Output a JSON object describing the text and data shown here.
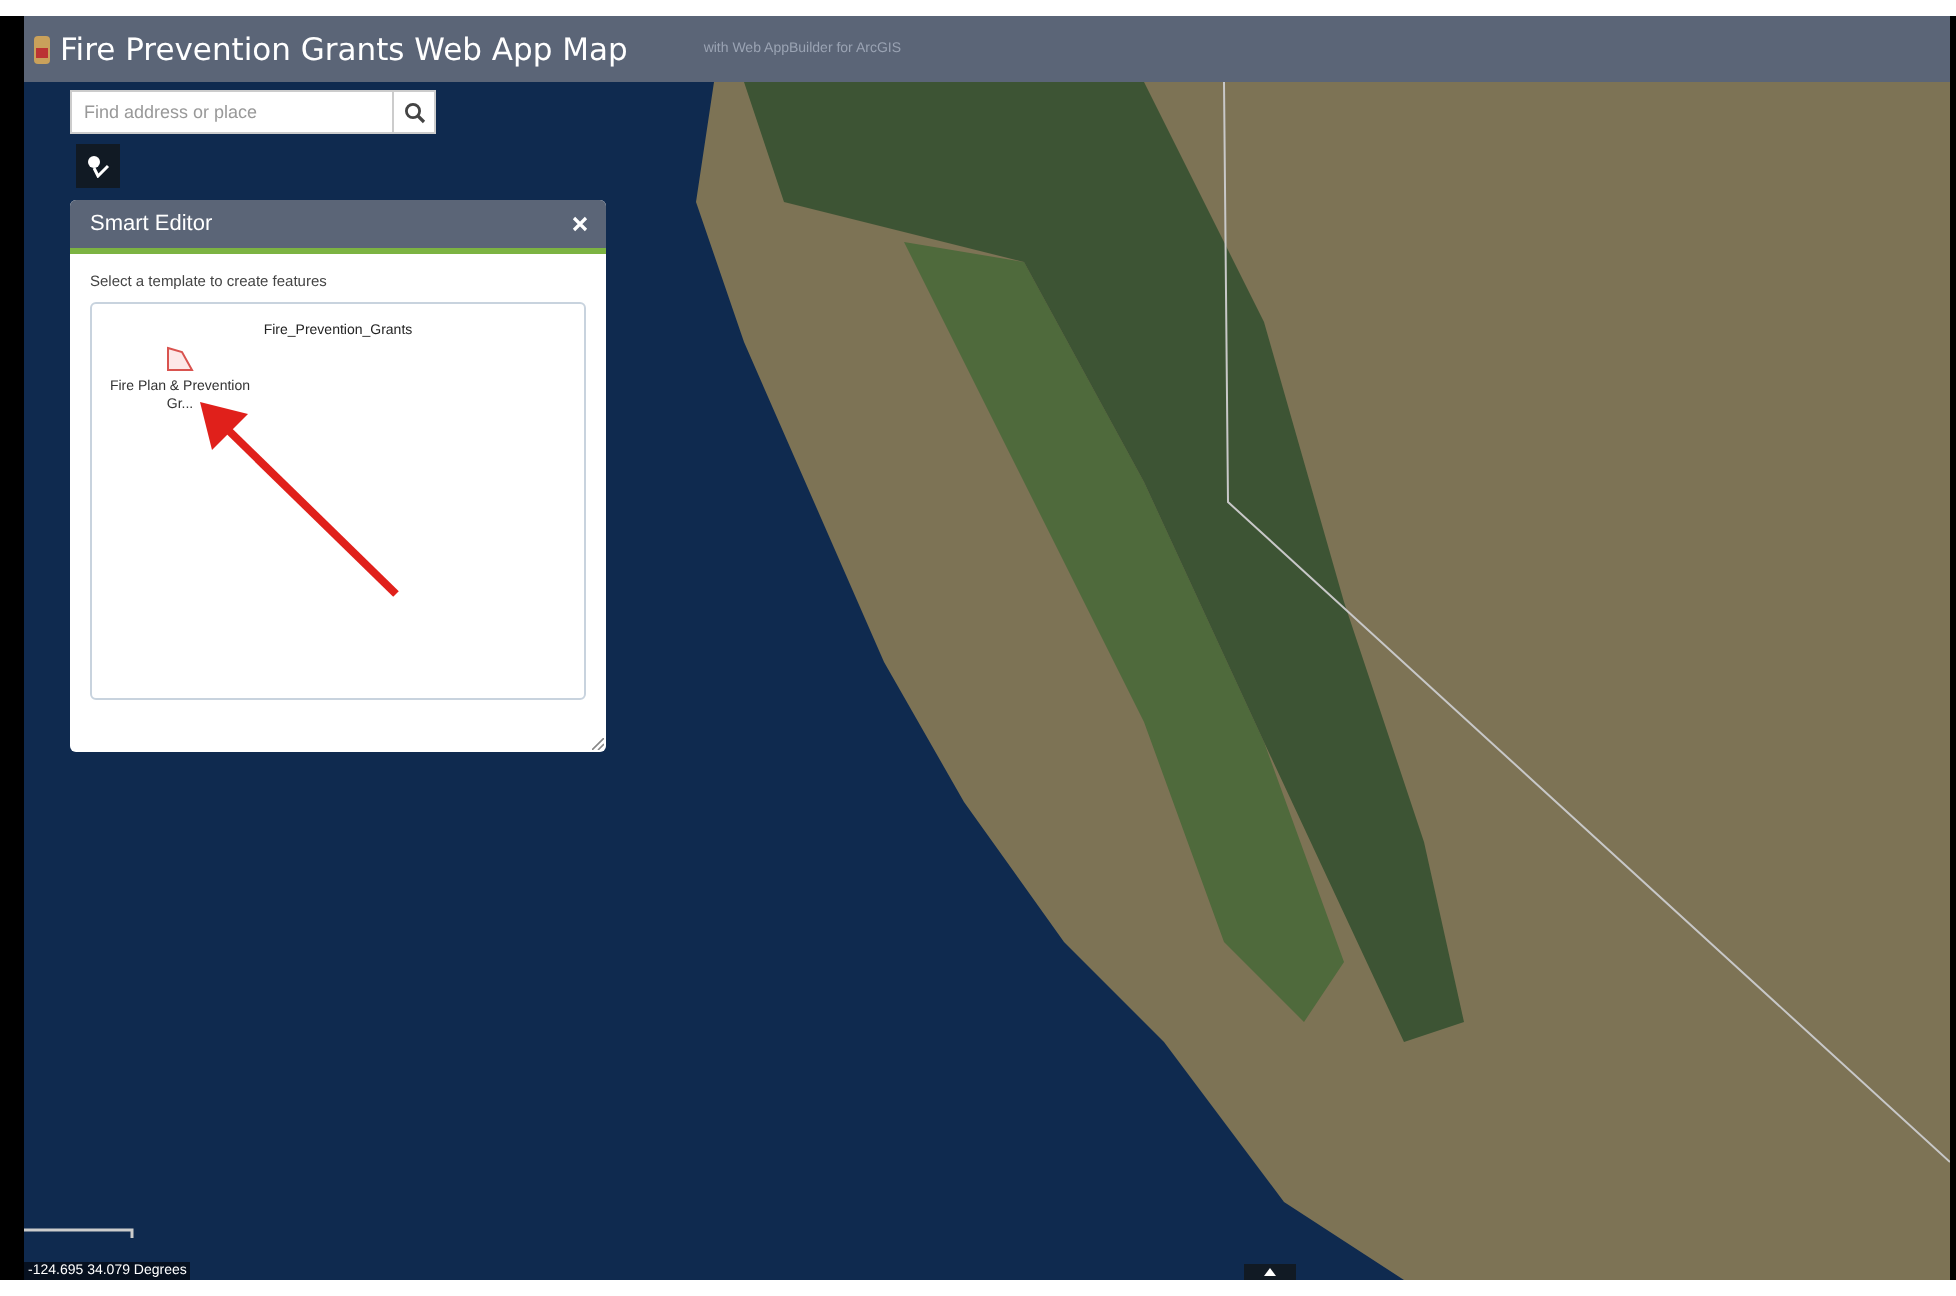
{
  "window": {
    "title": "Fire Prevention Grants Web App Map",
    "subtitle": "with Web AppBuilder for ArcGIS"
  },
  "search": {
    "placeholder": "Find address or place"
  },
  "panel": {
    "title": "Smart Editor",
    "instruction": "Select a template to create features",
    "layer": "Fire_Prevention_Grants",
    "templates": [
      {
        "label": "Fire Plan & Prevention Gr...",
        "kind": "polygon"
      }
    ]
  },
  "coordinates": "-124.695 34.079 Degrees"
}
